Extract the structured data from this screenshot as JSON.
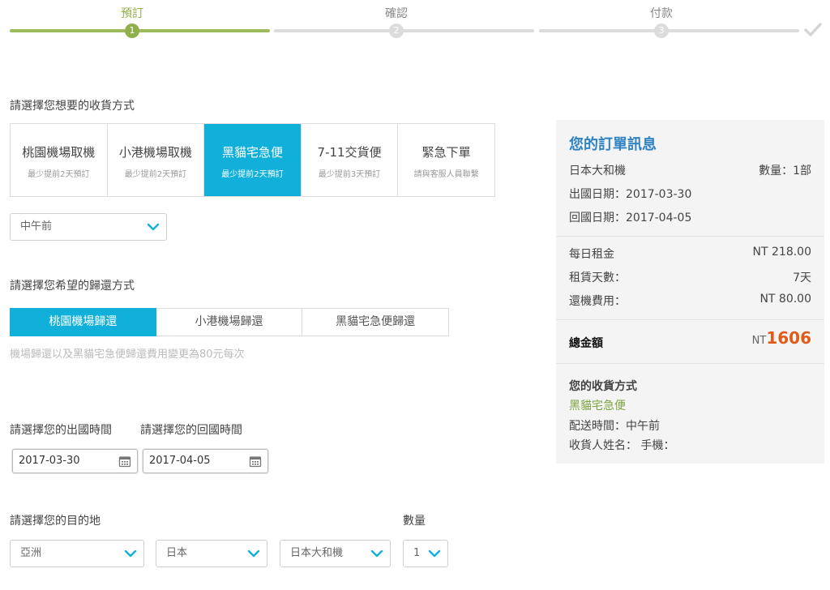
{
  "steps": [
    {
      "label": "預訂",
      "number": "1",
      "active": true
    },
    {
      "label": "確認",
      "number": "2",
      "active": false
    },
    {
      "label": "付款",
      "number": "3",
      "active": false
    }
  ],
  "delivery": {
    "title": "請選擇您想要的收貨方式",
    "options": [
      {
        "title": "桃園機場取機",
        "sub": "最少提前2天預訂"
      },
      {
        "title": "小港機場取機",
        "sub": "最少提前2天預訂"
      },
      {
        "title": "黑貓宅急便",
        "sub": "最少提前2天預訂"
      },
      {
        "title": "7-11交貨便",
        "sub": "最少提前3天預訂"
      },
      {
        "title": "緊急下單",
        "sub": "請與客服人員聯繫"
      }
    ],
    "selected_index": 2,
    "time_select": "中午前"
  },
  "return": {
    "title": "請選擇您希望的歸還方式",
    "options": [
      "桃園機場歸還",
      "小港機場歸還",
      "黑貓宅急便歸還"
    ],
    "selected_index": 0,
    "note": "機場歸還以及黑貓宅急便歸還費用變更為80元每次"
  },
  "dates": {
    "depart_label": "請選擇您的出國時間",
    "return_label": "請選擇您的回國時間",
    "depart_value": "2017-03-30",
    "return_value": "2017-04-05"
  },
  "destination": {
    "label": "請選擇您的目的地",
    "qty_label": "數量",
    "region": "亞洲",
    "country": "日本",
    "device": "日本大和機",
    "qty": "1"
  },
  "summary": {
    "title": "您的訂單訊息",
    "product": "日本大和機",
    "qty_text": "數量：1部",
    "depart": "出國日期：2017-03-30",
    "return": "回國日期：2017-04-05",
    "daily_label": "每日租金",
    "daily_value": "NT 218.00",
    "days_label": "租賃天數：",
    "days_value": "7天",
    "fee_label": "還機費用：",
    "fee_value": "NT 80.00",
    "total_label": "總金額",
    "total_currency": "NT",
    "total_value": "1606",
    "method_title": "您的收貨方式",
    "method_value": "黑貓宅急便",
    "delivery_time": "配送時間：中午前",
    "recipient": "收貨人姓名：  手機："
  },
  "colors": {
    "accent": "#11b0da",
    "step_active": "#8fb04a",
    "summary_title": "#2f83c4",
    "total": "#e05a1a"
  }
}
